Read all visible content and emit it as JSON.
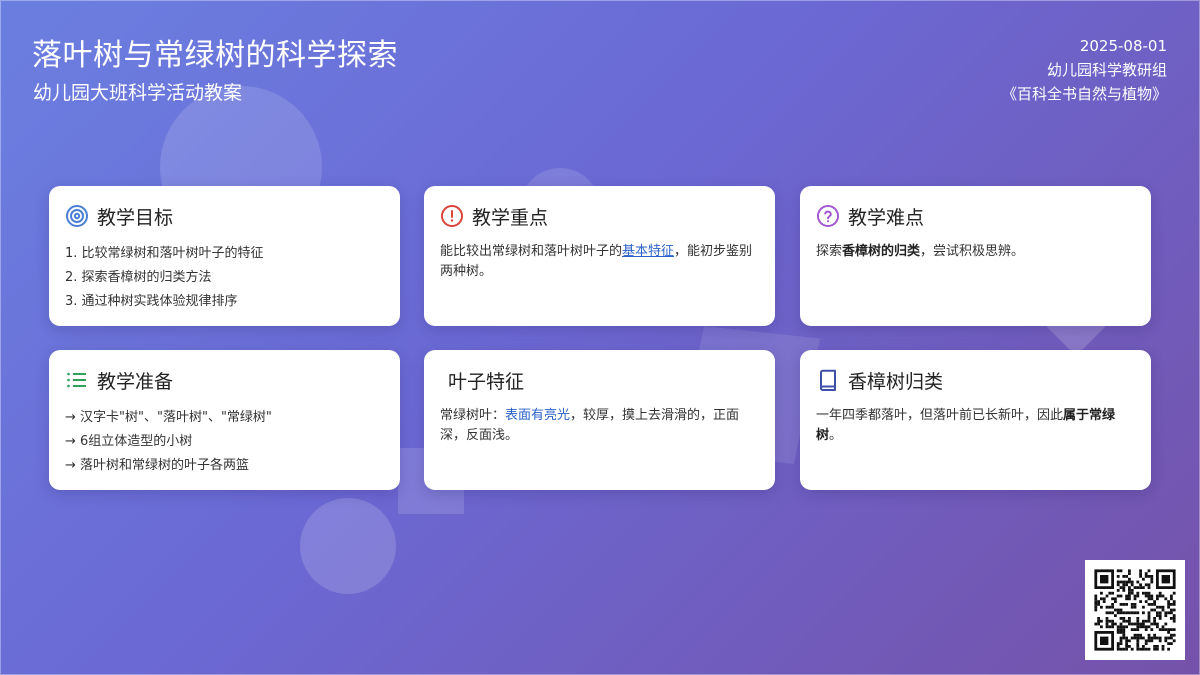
{
  "header": {
    "title": "落叶树与常绿树的科学探索",
    "subtitle": "幼儿园大班科学活动教案",
    "date": "2025-08-01",
    "author": "幼儿园科学教研组",
    "source": "《百科全书自然与植物》"
  },
  "cards": {
    "objectives": {
      "icon": "target-icon",
      "title": "教学目标",
      "items": [
        "1. 比较常绿树和落叶树叶子的特征",
        "2. 探索香樟树的归类方法",
        "3. 通过种树实践体验规律排序"
      ]
    },
    "key_points": {
      "icon": "alert-circle-icon",
      "title": "教学重点",
      "text_before": "能比较出常绿树和落叶树叶子的",
      "link": "基本特征",
      "text_after": "，能初步鉴别两种树。"
    },
    "difficulty": {
      "icon": "question-circle-icon",
      "title": "教学难点",
      "text_before": "探索",
      "bold": "香樟树的归类",
      "text_after": "，尝试积极思辨。"
    },
    "preparation": {
      "icon": "list-icon",
      "title": "教学准备",
      "items": [
        "→ 汉字卡\"树\"、\"落叶树\"、\"常绿树\"",
        "→ 6组立体造型的小树",
        "→ 落叶树和常绿树的叶子各两篮"
      ]
    },
    "leaf_features": {
      "title": "叶子特征",
      "text_before": "常绿树叶：",
      "highlight": "表面有亮光",
      "text_after": "，较厚，摸上去滑滑的，正面深，反面浅。"
    },
    "camphor": {
      "icon": "book-icon",
      "title": "香樟树归类",
      "text_before": "一年四季都落叶，但落叶前已长新叶，因此",
      "bold": "属于常绿树",
      "text_after": "。"
    }
  },
  "colors": {
    "target": "#4a7fd4",
    "alert": "#d9453b",
    "question": "#a259d0",
    "list": "#2fa05a",
    "book": "#3f4fa8",
    "link": "#2a62c9"
  }
}
